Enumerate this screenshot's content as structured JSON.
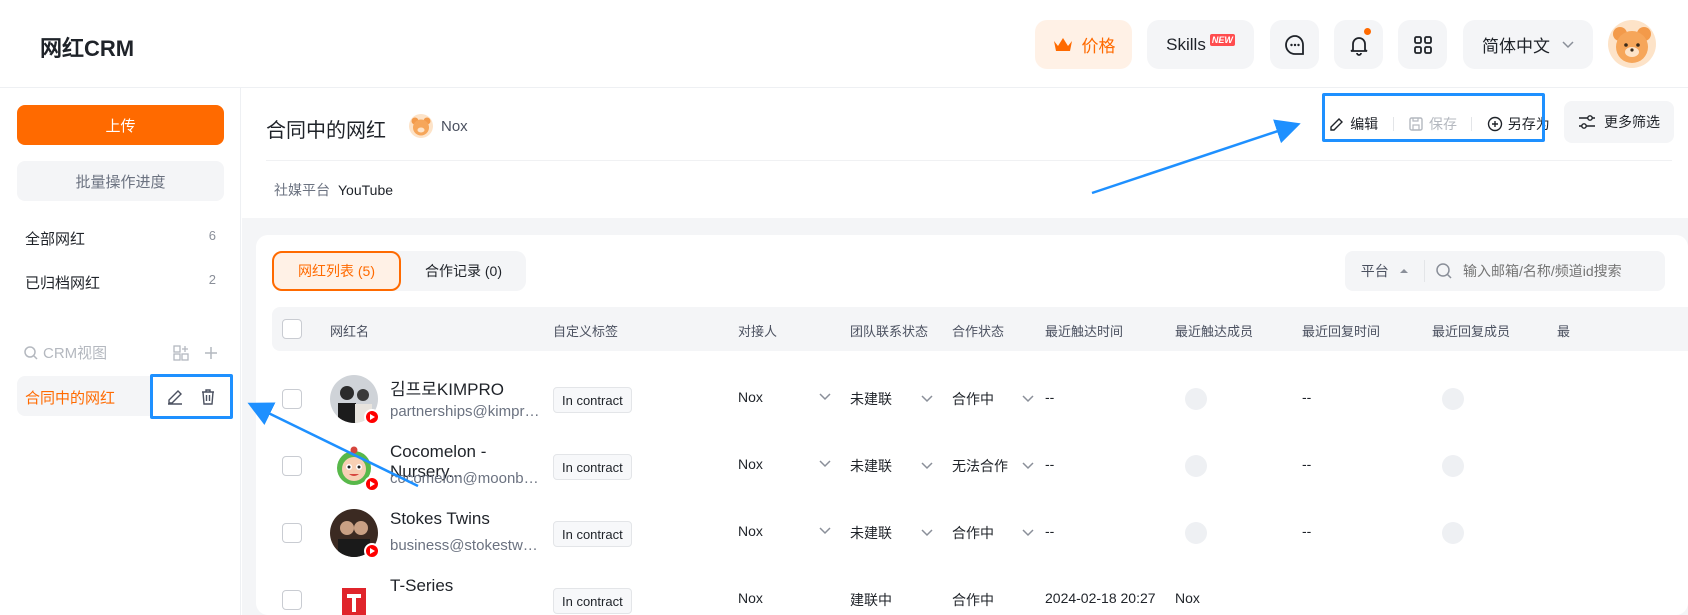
{
  "header": {
    "logo": "网红CRM",
    "price_label": "价格",
    "skills_label": "Skills",
    "skills_badge": "NEW",
    "language": "简体中文",
    "accent": "#ff6a00"
  },
  "sidebar": {
    "upload_label": "上传",
    "batch_label": "批量操作进度",
    "items": [
      {
        "label": "全部网红",
        "count": "6"
      },
      {
        "label": "已归档网红",
        "count": "2"
      }
    ],
    "crm_view_label": "CRM视图",
    "active_view": "合同中的网红"
  },
  "view": {
    "title": "合同中的网红",
    "owner": "Nox",
    "edit_label": "编辑",
    "save_label": "保存",
    "save_as_label": "另存为",
    "more_filter_label": "更多筛选",
    "platform_label": "社媒平台",
    "platform_value": "YouTube"
  },
  "tabs": [
    {
      "label": "网红列表 (5)"
    },
    {
      "label": "合作记录 (0)"
    }
  ],
  "search": {
    "platform_label": "平台",
    "placeholder": "输入邮箱/名称/频道id搜索"
  },
  "table": {
    "columns": [
      "网红名",
      "自定义标签",
      "对接人",
      "团队联系状态",
      "合作状态",
      "最近触达时间",
      "最近触达成员",
      "最近回复时间",
      "最近回复成员",
      "最"
    ],
    "rows": [
      {
        "name": "김프로KIMPRO",
        "email": "partnerships@kimpro...",
        "tag": "In contract",
        "contact": "Nox",
        "team_status": "未建联",
        "coop_status": "合作中",
        "last_touch": "--",
        "last_reply": "--"
      },
      {
        "name": "Cocomelon - Nursery...",
        "email": "cocomelon@moonbug...",
        "tag": "In contract",
        "contact": "Nox",
        "team_status": "未建联",
        "coop_status": "无法合作",
        "last_touch": "--",
        "last_reply": "--"
      },
      {
        "name": "Stokes Twins",
        "email": "business@stokestwins...",
        "tag": "In contract",
        "contact": "Nox",
        "team_status": "未建联",
        "coop_status": "合作中",
        "last_touch": "--",
        "last_reply": "--"
      },
      {
        "name": "T-Series",
        "email": "",
        "tag": "In contract",
        "contact": "Nox",
        "team_status": "建联中",
        "coop_status": "合作中",
        "last_touch": "2024-02-18 20:27",
        "last_touch_member": "Nox",
        "last_reply": ""
      }
    ]
  }
}
